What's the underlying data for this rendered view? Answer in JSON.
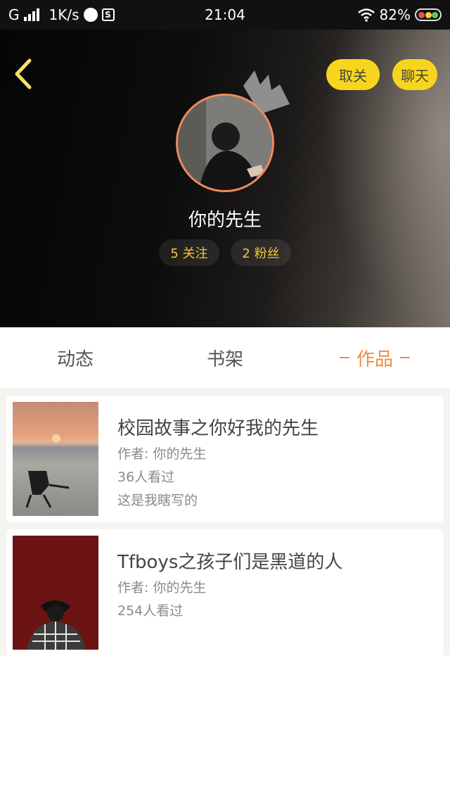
{
  "status_bar": {
    "carrier": "G",
    "speed": "1K/s",
    "time": "21:04",
    "battery": "82%"
  },
  "header": {
    "unfollow_label": "取关",
    "chat_label": "聊天",
    "username": "你的先生",
    "follow_label": "5 关注",
    "fans_label": "2 粉丝",
    "accent_color": "#f7d51e"
  },
  "tabs": [
    {
      "label": "动态",
      "active": false
    },
    {
      "label": "书架",
      "active": false
    },
    {
      "label": "作品",
      "active": true
    }
  ],
  "works": [
    {
      "title": "校园故事之你好我的先生",
      "author": "作者: 你的先生",
      "views": "36人看过",
      "description": "这是我瞎写的"
    },
    {
      "title": "Tfboys之孩子们是黑道的人",
      "author": "作者: 你的先生",
      "views": "254人看过"
    }
  ],
  "icons": [
    "back-arrow-icon",
    "crown-icon",
    "signal-icon",
    "wifi-icon",
    "battery-icon"
  ]
}
